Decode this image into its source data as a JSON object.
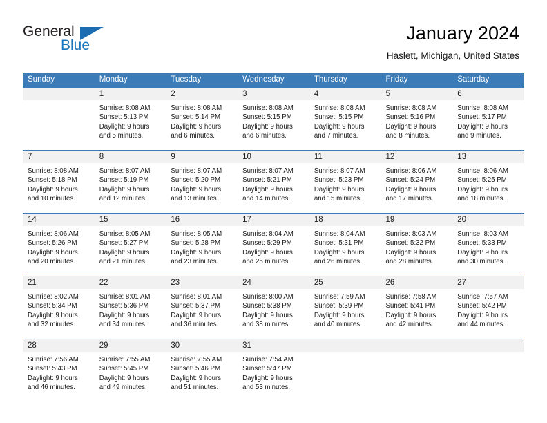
{
  "logo": {
    "word_one": "General",
    "word_two": "Blue",
    "icon": "triangle-icon",
    "brand_color": "#1b6cb0"
  },
  "header": {
    "title": "January 2024",
    "subtitle": "Haslett, Michigan, United States"
  },
  "theme": {
    "header_blue": "#3b7cb8",
    "band_gray": "#f1f1f1",
    "text": "#1a1a1a"
  },
  "weekdays": [
    "Sunday",
    "Monday",
    "Tuesday",
    "Wednesday",
    "Thursday",
    "Friday",
    "Saturday"
  ],
  "weeks": [
    [
      {
        "day": "",
        "sunrise": "",
        "sunset": "",
        "daylight_1": "",
        "daylight_2": ""
      },
      {
        "day": "1",
        "sunrise": "Sunrise: 8:08 AM",
        "sunset": "Sunset: 5:13 PM",
        "daylight_1": "Daylight: 9 hours",
        "daylight_2": "and 5 minutes."
      },
      {
        "day": "2",
        "sunrise": "Sunrise: 8:08 AM",
        "sunset": "Sunset: 5:14 PM",
        "daylight_1": "Daylight: 9 hours",
        "daylight_2": "and 6 minutes."
      },
      {
        "day": "3",
        "sunrise": "Sunrise: 8:08 AM",
        "sunset": "Sunset: 5:15 PM",
        "daylight_1": "Daylight: 9 hours",
        "daylight_2": "and 6 minutes."
      },
      {
        "day": "4",
        "sunrise": "Sunrise: 8:08 AM",
        "sunset": "Sunset: 5:15 PM",
        "daylight_1": "Daylight: 9 hours",
        "daylight_2": "and 7 minutes."
      },
      {
        "day": "5",
        "sunrise": "Sunrise: 8:08 AM",
        "sunset": "Sunset: 5:16 PM",
        "daylight_1": "Daylight: 9 hours",
        "daylight_2": "and 8 minutes."
      },
      {
        "day": "6",
        "sunrise": "Sunrise: 8:08 AM",
        "sunset": "Sunset: 5:17 PM",
        "daylight_1": "Daylight: 9 hours",
        "daylight_2": "and 9 minutes."
      }
    ],
    [
      {
        "day": "7",
        "sunrise": "Sunrise: 8:08 AM",
        "sunset": "Sunset: 5:18 PM",
        "daylight_1": "Daylight: 9 hours",
        "daylight_2": "and 10 minutes."
      },
      {
        "day": "8",
        "sunrise": "Sunrise: 8:07 AM",
        "sunset": "Sunset: 5:19 PM",
        "daylight_1": "Daylight: 9 hours",
        "daylight_2": "and 12 minutes."
      },
      {
        "day": "9",
        "sunrise": "Sunrise: 8:07 AM",
        "sunset": "Sunset: 5:20 PM",
        "daylight_1": "Daylight: 9 hours",
        "daylight_2": "and 13 minutes."
      },
      {
        "day": "10",
        "sunrise": "Sunrise: 8:07 AM",
        "sunset": "Sunset: 5:21 PM",
        "daylight_1": "Daylight: 9 hours",
        "daylight_2": "and 14 minutes."
      },
      {
        "day": "11",
        "sunrise": "Sunrise: 8:07 AM",
        "sunset": "Sunset: 5:23 PM",
        "daylight_1": "Daylight: 9 hours",
        "daylight_2": "and 15 minutes."
      },
      {
        "day": "12",
        "sunrise": "Sunrise: 8:06 AM",
        "sunset": "Sunset: 5:24 PM",
        "daylight_1": "Daylight: 9 hours",
        "daylight_2": "and 17 minutes."
      },
      {
        "day": "13",
        "sunrise": "Sunrise: 8:06 AM",
        "sunset": "Sunset: 5:25 PM",
        "daylight_1": "Daylight: 9 hours",
        "daylight_2": "and 18 minutes."
      }
    ],
    [
      {
        "day": "14",
        "sunrise": "Sunrise: 8:06 AM",
        "sunset": "Sunset: 5:26 PM",
        "daylight_1": "Daylight: 9 hours",
        "daylight_2": "and 20 minutes."
      },
      {
        "day": "15",
        "sunrise": "Sunrise: 8:05 AM",
        "sunset": "Sunset: 5:27 PM",
        "daylight_1": "Daylight: 9 hours",
        "daylight_2": "and 21 minutes."
      },
      {
        "day": "16",
        "sunrise": "Sunrise: 8:05 AM",
        "sunset": "Sunset: 5:28 PM",
        "daylight_1": "Daylight: 9 hours",
        "daylight_2": "and 23 minutes."
      },
      {
        "day": "17",
        "sunrise": "Sunrise: 8:04 AM",
        "sunset": "Sunset: 5:29 PM",
        "daylight_1": "Daylight: 9 hours",
        "daylight_2": "and 25 minutes."
      },
      {
        "day": "18",
        "sunrise": "Sunrise: 8:04 AM",
        "sunset": "Sunset: 5:31 PM",
        "daylight_1": "Daylight: 9 hours",
        "daylight_2": "and 26 minutes."
      },
      {
        "day": "19",
        "sunrise": "Sunrise: 8:03 AM",
        "sunset": "Sunset: 5:32 PM",
        "daylight_1": "Daylight: 9 hours",
        "daylight_2": "and 28 minutes."
      },
      {
        "day": "20",
        "sunrise": "Sunrise: 8:03 AM",
        "sunset": "Sunset: 5:33 PM",
        "daylight_1": "Daylight: 9 hours",
        "daylight_2": "and 30 minutes."
      }
    ],
    [
      {
        "day": "21",
        "sunrise": "Sunrise: 8:02 AM",
        "sunset": "Sunset: 5:34 PM",
        "daylight_1": "Daylight: 9 hours",
        "daylight_2": "and 32 minutes."
      },
      {
        "day": "22",
        "sunrise": "Sunrise: 8:01 AM",
        "sunset": "Sunset: 5:36 PM",
        "daylight_1": "Daylight: 9 hours",
        "daylight_2": "and 34 minutes."
      },
      {
        "day": "23",
        "sunrise": "Sunrise: 8:01 AM",
        "sunset": "Sunset: 5:37 PM",
        "daylight_1": "Daylight: 9 hours",
        "daylight_2": "and 36 minutes."
      },
      {
        "day": "24",
        "sunrise": "Sunrise: 8:00 AM",
        "sunset": "Sunset: 5:38 PM",
        "daylight_1": "Daylight: 9 hours",
        "daylight_2": "and 38 minutes."
      },
      {
        "day": "25",
        "sunrise": "Sunrise: 7:59 AM",
        "sunset": "Sunset: 5:39 PM",
        "daylight_1": "Daylight: 9 hours",
        "daylight_2": "and 40 minutes."
      },
      {
        "day": "26",
        "sunrise": "Sunrise: 7:58 AM",
        "sunset": "Sunset: 5:41 PM",
        "daylight_1": "Daylight: 9 hours",
        "daylight_2": "and 42 minutes."
      },
      {
        "day": "27",
        "sunrise": "Sunrise: 7:57 AM",
        "sunset": "Sunset: 5:42 PM",
        "daylight_1": "Daylight: 9 hours",
        "daylight_2": "and 44 minutes."
      }
    ],
    [
      {
        "day": "28",
        "sunrise": "Sunrise: 7:56 AM",
        "sunset": "Sunset: 5:43 PM",
        "daylight_1": "Daylight: 9 hours",
        "daylight_2": "and 46 minutes."
      },
      {
        "day": "29",
        "sunrise": "Sunrise: 7:55 AM",
        "sunset": "Sunset: 5:45 PM",
        "daylight_1": "Daylight: 9 hours",
        "daylight_2": "and 49 minutes."
      },
      {
        "day": "30",
        "sunrise": "Sunrise: 7:55 AM",
        "sunset": "Sunset: 5:46 PM",
        "daylight_1": "Daylight: 9 hours",
        "daylight_2": "and 51 minutes."
      },
      {
        "day": "31",
        "sunrise": "Sunrise: 7:54 AM",
        "sunset": "Sunset: 5:47 PM",
        "daylight_1": "Daylight: 9 hours",
        "daylight_2": "and 53 minutes."
      },
      {
        "day": "",
        "sunrise": "",
        "sunset": "",
        "daylight_1": "",
        "daylight_2": ""
      },
      {
        "day": "",
        "sunrise": "",
        "sunset": "",
        "daylight_1": "",
        "daylight_2": ""
      },
      {
        "day": "",
        "sunrise": "",
        "sunset": "",
        "daylight_1": "",
        "daylight_2": ""
      }
    ]
  ]
}
